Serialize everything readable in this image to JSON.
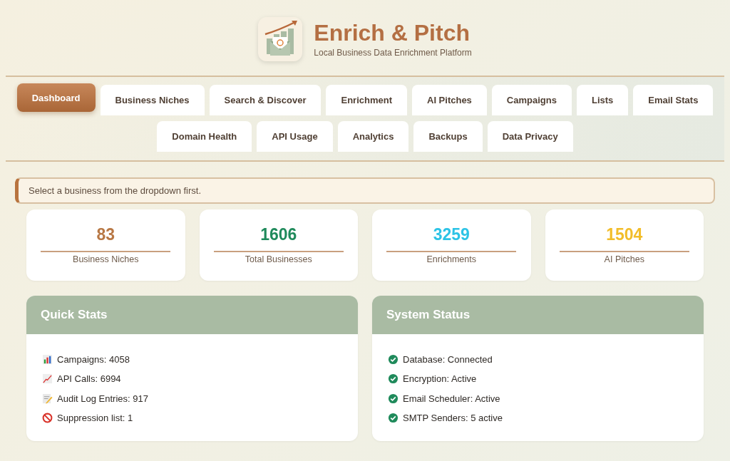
{
  "header": {
    "title": "Enrich & Pitch",
    "subtitle": "Local Business Data Enrichment Platform"
  },
  "tabs": [
    {
      "label": "Dashboard",
      "selected": true
    },
    {
      "label": "Business Niches",
      "selected": false
    },
    {
      "label": "Search & Discover",
      "selected": false
    },
    {
      "label": "Enrichment",
      "selected": false
    },
    {
      "label": "AI Pitches",
      "selected": false
    },
    {
      "label": "Campaigns",
      "selected": false
    },
    {
      "label": "Lists",
      "selected": false
    },
    {
      "label": "Email Stats",
      "selected": false
    },
    {
      "label": "Domain Health",
      "selected": false
    },
    {
      "label": "API Usage",
      "selected": false
    },
    {
      "label": "Analytics",
      "selected": false
    },
    {
      "label": "Backups",
      "selected": false
    },
    {
      "label": "Data Privacy",
      "selected": false
    }
  ],
  "alert": "Select a business from the dropdown first.",
  "stats": [
    {
      "value": "83",
      "label": "Business Niches",
      "color": "#b87845"
    },
    {
      "value": "1606",
      "label": "Total Businesses",
      "color": "#1f8a5b"
    },
    {
      "value": "3259",
      "label": "Enrichments",
      "color": "#2cc3e6"
    },
    {
      "value": "1504",
      "label": "AI Pitches",
      "color": "#f2bd2a"
    }
  ],
  "quick_stats": {
    "title": "Quick Stats",
    "items": [
      {
        "kind": "bars",
        "text": "Campaigns: 4058"
      },
      {
        "kind": "trend",
        "text": "API Calls: 6994"
      },
      {
        "kind": "memo",
        "text": "Audit Log Entries: 917"
      },
      {
        "kind": "blocked",
        "text": "Suppression list: 1"
      }
    ]
  },
  "system_status": {
    "title": "System Status",
    "items": [
      {
        "ok": true,
        "text": "Database: Connected"
      },
      {
        "ok": true,
        "text": "Encryption: Active"
      },
      {
        "ok": true,
        "text": "Email Scheduler: Active"
      },
      {
        "ok": true,
        "text": "SMTP Senders: 5 active"
      }
    ]
  }
}
